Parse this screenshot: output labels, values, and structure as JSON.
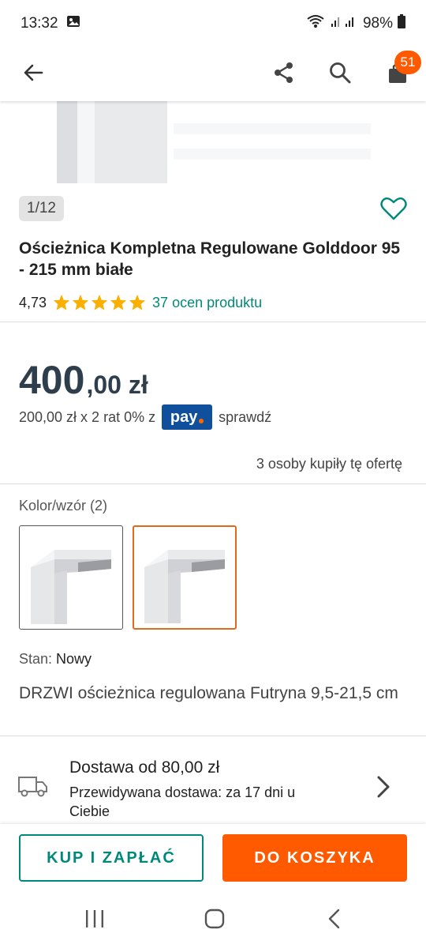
{
  "status_bar": {
    "time": "13:32",
    "battery": "98%",
    "icons": [
      "gallery-icon",
      "wifi-icon",
      "signal-icon",
      "battery-icon"
    ]
  },
  "app_bar": {
    "icons": [
      "back-arrow-icon",
      "share-icon",
      "search-icon",
      "cart-icon"
    ],
    "cart_count": "51"
  },
  "gallery": {
    "counter": "1/12"
  },
  "product": {
    "title": "Ościeżnica Kompletna Regulowane Golddoor 95 - 215 mm białe",
    "rating": "4,73",
    "stars": 5,
    "reviews_link": "37 ocen produktu"
  },
  "pricing": {
    "price_main": "400",
    "price_rest": ",00 zł",
    "installments_text": "200,00 zł x 2 rat 0% z",
    "pay_logo": "pay",
    "check_link": "sprawdź",
    "bought_text": "3 osoby kupiły tę ofertę"
  },
  "variants": {
    "label": "Kolor/wzór (2)",
    "selected_index": 1
  },
  "condition": {
    "label": "Stan:",
    "value": "Nowy"
  },
  "description": "DRZWI ościeżnica regulowana Futryna 9,5-21,5 cm",
  "delivery": {
    "title": "Dostawa od 80,00 zł",
    "subtitle": "Przewidywana dostawa: za 17 dni u Ciebie"
  },
  "actions": {
    "buy_label": "KUP I ZAPŁAĆ",
    "cart_label": "DO KOSZYKA"
  },
  "colors": {
    "accent_teal": "#00897b",
    "accent_orange": "#ff5a00",
    "price": "#2f3e4c",
    "star": "#f9b000"
  }
}
